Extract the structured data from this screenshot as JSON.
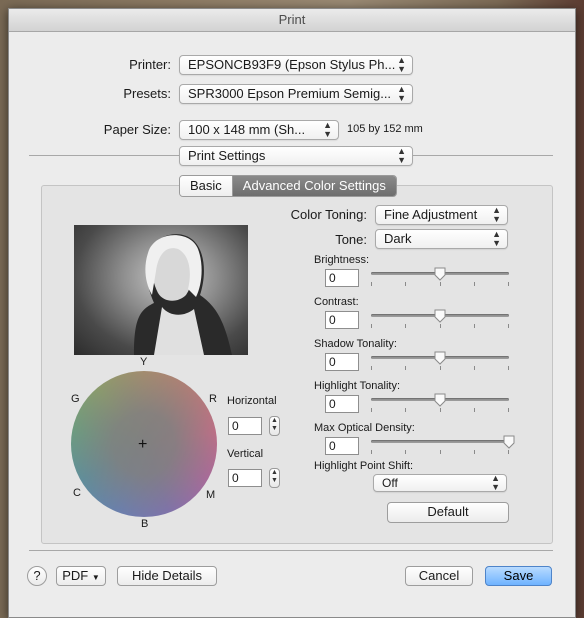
{
  "window": {
    "title": "Print"
  },
  "printer": {
    "label": "Printer:",
    "value": "EPSONCB93F9 (Epson Stylus Ph..."
  },
  "presets": {
    "label": "Presets:",
    "value": "SPR3000 Epson Premium Semig..."
  },
  "paper": {
    "label": "Paper Size:",
    "value": "100 x 148 mm (Sh...",
    "dimensions": "105 by 152 mm"
  },
  "section_popup": {
    "value": "Print Settings"
  },
  "tabs": [
    {
      "label": "Basic",
      "selected": false
    },
    {
      "label": "Advanced Color Settings",
      "selected": true
    }
  ],
  "color_toning": {
    "label": "Color Toning:",
    "value": "Fine Adjustment"
  },
  "tone": {
    "label": "Tone:",
    "value": "Dark"
  },
  "sliders": [
    {
      "label": "Brightness:",
      "value": "0",
      "level": 0.5
    },
    {
      "label": "Contrast:",
      "value": "0",
      "level": 0.5
    },
    {
      "label": "Shadow Tonality:",
      "value": "0",
      "level": 0.5
    },
    {
      "label": "Highlight Tonality:",
      "value": "0",
      "level": 0.5
    },
    {
      "label": "Max Optical Density:",
      "value": "0",
      "level": 1.0
    }
  ],
  "highlight_point_shift": {
    "label": "Highlight Point Shift:",
    "value": "Off"
  },
  "default_button": "Default",
  "wheel": {
    "top": "Y",
    "left_top": "G",
    "right_top": "R",
    "left_bottom": "C",
    "right_bottom": "M",
    "bottom": "B",
    "center": "+"
  },
  "horizontal": {
    "label": "Horizontal",
    "value": "0"
  },
  "vertical": {
    "label": "Vertical",
    "value": "0"
  },
  "bottom": {
    "help": "?",
    "pdf": "PDF",
    "hide_details": "Hide Details",
    "cancel": "Cancel",
    "save": "Save"
  }
}
